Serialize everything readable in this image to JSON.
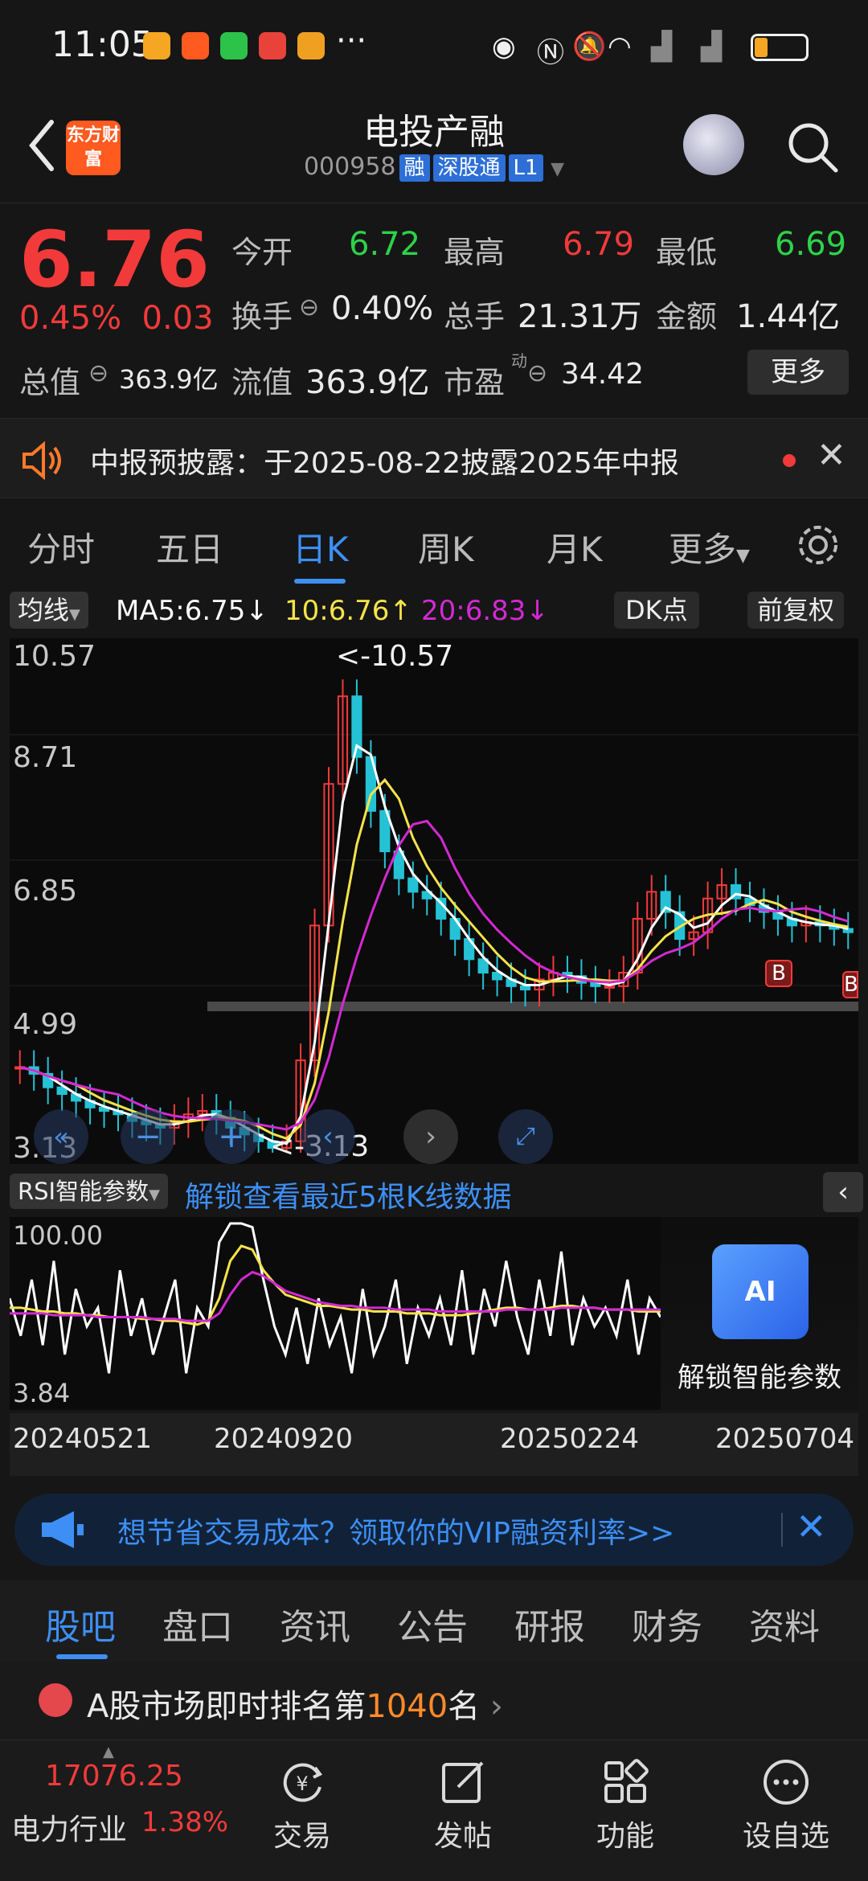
{
  "status_bar": {
    "time": "11:05",
    "more": "···"
  },
  "header": {
    "back_icon": "chevron-left-icon",
    "logo_text": "东方财富",
    "stock_name": "电投产融",
    "stock_code": "000958",
    "tags": [
      "融",
      "深股通",
      "L1"
    ]
  },
  "quote": {
    "price": "6.76",
    "change_pct": "0.45%",
    "change_abs": "0.03",
    "fields": {
      "open_label": "今开",
      "open": "6.72",
      "high_label": "最高",
      "high": "6.79",
      "low_label": "最低",
      "low": "6.69",
      "turnover_label": "换手",
      "turnover": "0.40%",
      "volume_label": "总手",
      "volume": "21.31万",
      "amount_label": "金额",
      "amount": "1.44亿",
      "mktcap_label": "总值",
      "mktcap": "363.9亿",
      "float_label": "流值",
      "float": "363.9亿",
      "pe_label": "市盈",
      "pe_sup": "动",
      "pe": "34.42"
    },
    "more_button": "更多"
  },
  "notice": {
    "text": "中报预披露：于2025-08-22披露2025年中报"
  },
  "kline_tabs": [
    "分时",
    "五日",
    "日K",
    "周K",
    "月K",
    "更多"
  ],
  "kline_active_tab": "日K",
  "ma": {
    "selector": "均线",
    "ma5": "MA5:6.75↓",
    "ma10": "10:6.76↑",
    "ma20": "20:6.83↓",
    "dk_button": "DK点",
    "adjust_button": "前复权",
    "colors": {
      "ma5": "#ffffff",
      "ma10": "#f5e34a",
      "ma20": "#d22ad2"
    }
  },
  "chart_data": [
    {
      "type": "candlestick",
      "y_labels": [
        "10.57",
        "8.71",
        "6.85",
        "4.99",
        "3.13"
      ],
      "ylim": [
        3.13,
        10.57
      ],
      "max_marker": "<-10.57",
      "min_marker": "<-3.13",
      "buy_markers": [
        "B",
        "B"
      ],
      "close_series": [
        4.4,
        4.3,
        4.1,
        4.0,
        3.9,
        3.8,
        3.75,
        3.7,
        3.6,
        3.55,
        3.5,
        3.6,
        3.7,
        3.75,
        3.65,
        3.5,
        3.4,
        3.3,
        3.2,
        3.3,
        4.5,
        6.5,
        8.6,
        9.9,
        9.0,
        8.2,
        7.6,
        7.2,
        7.0,
        6.9,
        6.6,
        6.3,
        6.0,
        5.8,
        5.7,
        5.6,
        5.55,
        5.7,
        5.8,
        5.75,
        5.65,
        5.6,
        5.6,
        5.8,
        6.6,
        7.0,
        6.7,
        6.3,
        6.4,
        6.9,
        7.1,
        6.9,
        6.8,
        6.7,
        6.6,
        6.5,
        6.55,
        6.5,
        6.45,
        6.4
      ],
      "x_labels": [
        "20240521",
        "20240920",
        "20250224",
        "20250704"
      ]
    },
    {
      "type": "line",
      "indicator_selector": "RSI智能参数",
      "unlock_text": "解锁查看最近5根K线数据",
      "y_labels": [
        "100.00",
        "3.84"
      ],
      "ylim": [
        3.84,
        100
      ],
      "series": [
        {
          "values": [
            60,
            40,
            70,
            35,
            80,
            30,
            65,
            45,
            55,
            20,
            75,
            40,
            60,
            30,
            50,
            70,
            20,
            55,
            45,
            90,
            100,
            100,
            98,
            70,
            45,
            30,
            55,
            25,
            60,
            35,
            50,
            20,
            65,
            30,
            45,
            70,
            25,
            55,
            40,
            60,
            35,
            75,
            30,
            65,
            45,
            80,
            50,
            30,
            70,
            40,
            85,
            35,
            60,
            45,
            55,
            40,
            70,
            30,
            60,
            50
          ]
        },
        {
          "values": [
            55,
            55,
            54,
            53,
            53,
            52,
            52,
            51,
            51,
            50,
            50,
            50,
            49,
            49,
            48,
            48,
            47,
            46,
            48,
            60,
            80,
            88,
            86,
            75,
            68,
            62,
            60,
            58,
            56,
            56,
            55,
            54,
            54,
            53,
            53,
            53,
            52,
            52,
            52,
            51,
            51,
            51,
            52,
            53,
            54,
            55,
            55,
            54,
            54,
            55,
            56,
            56,
            55,
            55,
            54,
            54,
            54,
            53,
            53,
            53
          ]
        },
        {
          "values": [
            52,
            52,
            52,
            52,
            51,
            51,
            51,
            51,
            50,
            50,
            50,
            50,
            50,
            49,
            49,
            49,
            48,
            48,
            48,
            52,
            62,
            70,
            74,
            72,
            68,
            64,
            62,
            60,
            58,
            57,
            56,
            56,
            55,
            55,
            55,
            54,
            54,
            54,
            54,
            53,
            53,
            53,
            53,
            53,
            53,
            54,
            54,
            54,
            54,
            54,
            55,
            55,
            55,
            55,
            54,
            54,
            54,
            54,
            54,
            54
          ]
        }
      ]
    }
  ],
  "ai_unlock": {
    "icon_text": "AI",
    "label": "解锁智能参数"
  },
  "promo": {
    "text": "想节省交易成本？领取你的VIP融资利率>>"
  },
  "bottom_tabs": [
    "股吧",
    "盘口",
    "资讯",
    "公告",
    "研报",
    "财务",
    "资料"
  ],
  "bottom_active_tab": "股吧",
  "rank": {
    "prefix": "A股市场即时排名第",
    "number": "1040",
    "suffix": "名",
    "arrow": "›"
  },
  "industry": {
    "index_value": "17076.25",
    "name": "电力行业",
    "pct": "1.38%"
  },
  "nav": [
    {
      "label": "交易",
      "icon": "trade-yen-icon"
    },
    {
      "label": "发帖",
      "icon": "edit-post-icon"
    },
    {
      "label": "功能",
      "icon": "grid-function-icon"
    },
    {
      "label": "设自选",
      "icon": "favorite-dots-icon"
    }
  ]
}
